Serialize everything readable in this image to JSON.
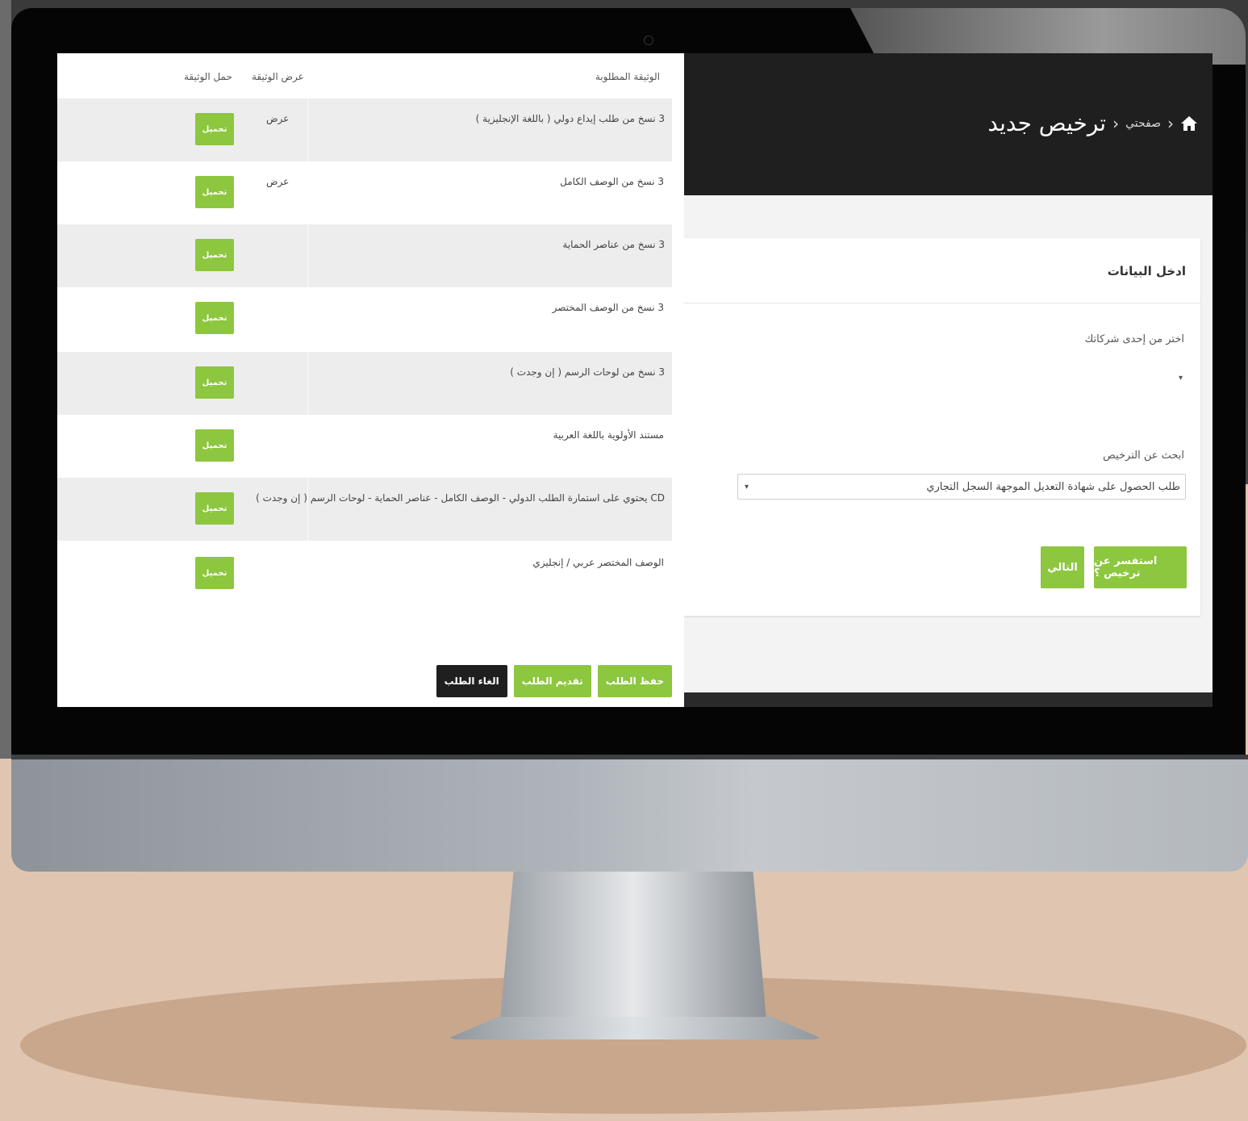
{
  "screen": {
    "breadcrumb": {
      "home_icon": "home-icon",
      "separator": "›",
      "home_label": "صفحتي",
      "current": "ترخيص جديد"
    },
    "card": {
      "title": "ادخل البيانات",
      "company_label": "اختر من إحدى شركاتك",
      "company_caret": "▾",
      "license_label": "ابحث عن الترخيص",
      "license_value": "طلب الحصول على شهادة التعديل الموجهة السجل التجاري",
      "license_caret": "▾",
      "inquire_button": "استفسر عن ترخيص ؟",
      "next_button": "التالي"
    }
  },
  "documents": {
    "headers": {
      "required_document": "الوثيقة المطلوبة",
      "view_document": "عرض الوثيقة",
      "upload_document": "حمل الوثيقة"
    },
    "rows": [
      {
        "name": "3 نسخ من طلب إيداع دولي ( باللغة الإنجليزية )",
        "view": "عرض",
        "upload": "تحميل"
      },
      {
        "name": "3 نسخ من الوصف الكامل",
        "view": "عرض",
        "upload": "تحميل"
      },
      {
        "name": "3 نسخ من عناصر الحماية",
        "view": "",
        "upload": "تحميل"
      },
      {
        "name": "3 نسخ من الوصف المختصر",
        "view": "",
        "upload": "تحميل"
      },
      {
        "name": "3 نسخ من لوحات الرسم ( إن وجدت )",
        "view": "",
        "upload": "تحميل"
      },
      {
        "name": "مستند الأولوية باللغة العربية",
        "view": "",
        "upload": "تحميل"
      },
      {
        "name": "CD يحتوي على استمارة الطلب الدولي - الوصف الكامل - عناصر الحماية - لوحات الرسم ( إن وجدت )",
        "view": "",
        "upload": "تحميل"
      },
      {
        "name": "الوصف المختصر عربي / إنجليزي",
        "view": "",
        "upload": "تحميل"
      }
    ],
    "actions": {
      "save": "حفظ الطلب",
      "submit": "تقديم الطلب",
      "cancel": "الغاء الطلب"
    }
  },
  "colors": {
    "accent_green": "#8dc63f",
    "header_dark": "#1f1f1f",
    "row_shade": "#ededed"
  }
}
